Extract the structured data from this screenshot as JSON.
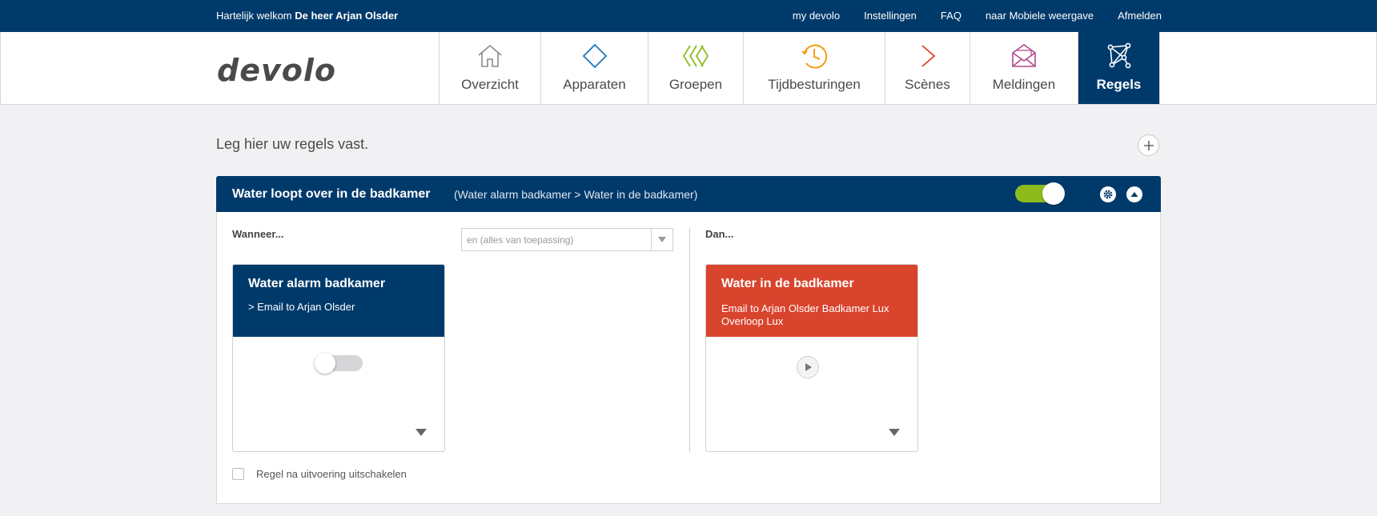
{
  "topbar": {
    "welcome_prefix": "Hartelijk welkom",
    "user_name": "De heer Arjan Olsder",
    "links": [
      "my devolo",
      "Instellingen",
      "FAQ",
      "naar Mobiele weergave",
      "Afmelden"
    ]
  },
  "header": {
    "logo": "devolo",
    "nav": [
      {
        "label": "Overzicht",
        "icon": "home-icon",
        "color": "#8a8a8a"
      },
      {
        "label": "Apparaten",
        "icon": "diamond-icon",
        "color": "#1a78c2"
      },
      {
        "label": "Groepen",
        "icon": "chevrons-icon",
        "color": "#8dbb1e"
      },
      {
        "label": "Tijdbesturingen",
        "icon": "clock-icon",
        "color": "#f39200"
      },
      {
        "label": "Scènes",
        "icon": "play-outline-icon",
        "color": "#d9442d"
      },
      {
        "label": "Meldingen",
        "icon": "envelope-icon",
        "color": "#b0488e"
      },
      {
        "label": "Regels",
        "icon": "network-icon",
        "color": "#ffffff",
        "active": true
      }
    ]
  },
  "main": {
    "title": "Leg hier uw regels vast.",
    "add_icon": "plus-icon"
  },
  "rule": {
    "name": "Water loopt over in de badkamer",
    "path": "(Water alarm badkamer > Water in de badkamer)",
    "enabled": true,
    "when_label": "Wanneer...",
    "then_label": "Dan...",
    "operator_value": "en (alles van toepassing)",
    "condition_card": {
      "title": "Water alarm badkamer",
      "subtitle": "> Email to Arjan Olsder",
      "toggle_on": false
    },
    "action_card": {
      "title": "Water in de badkamer",
      "subtitle": "Email to Arjan Olsder Badkamer Lux Overloop Lux"
    },
    "disable_after_label": "Regel na uitvoering uitschakelen",
    "disable_after_checked": false
  },
  "colors": {
    "brand_blue": "#003a6b",
    "toggle_green": "#8dbb1e",
    "action_red": "#d9442d"
  }
}
